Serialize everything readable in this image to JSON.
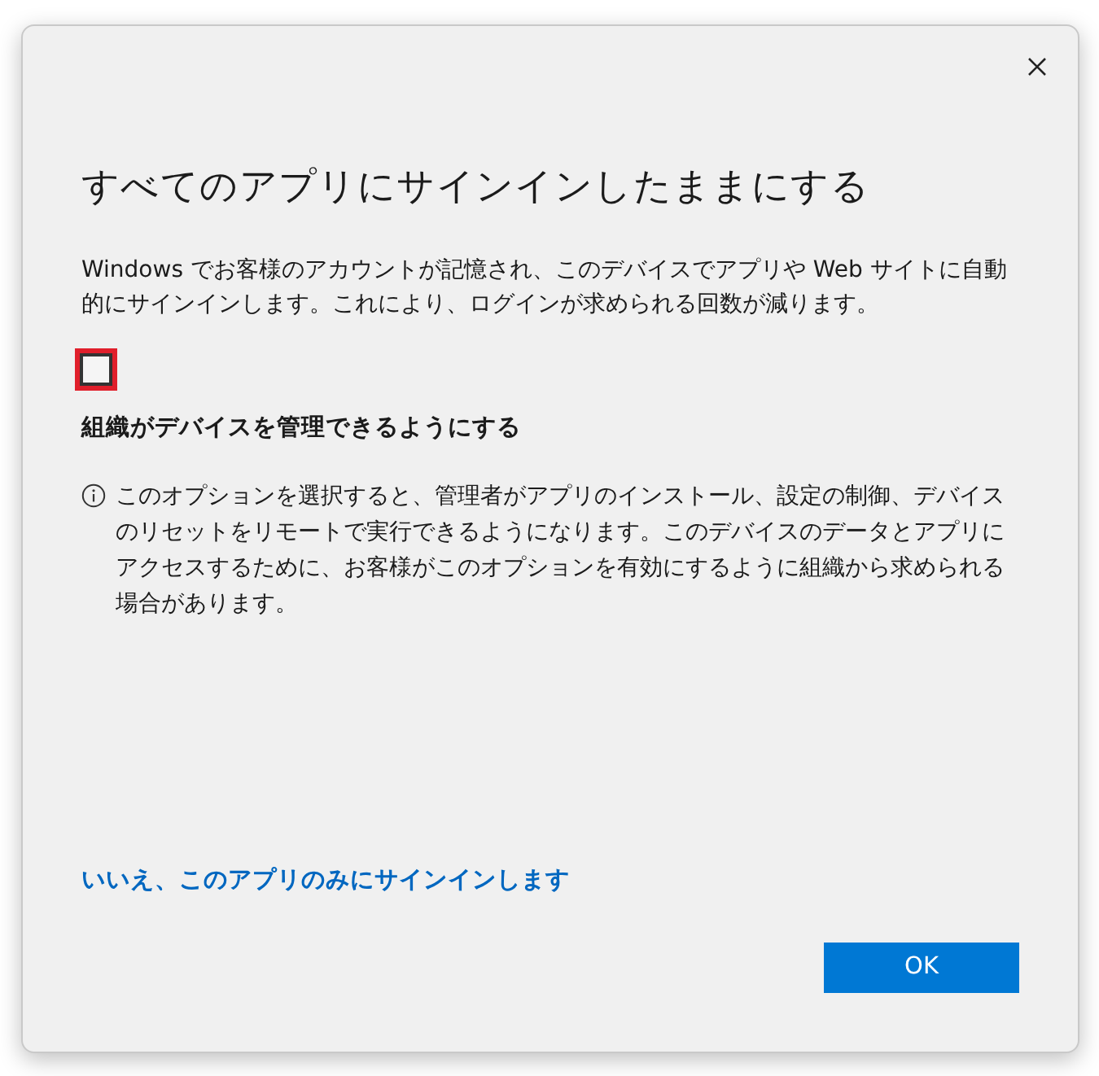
{
  "dialog": {
    "title": "すべてのアプリにサインインしたままにする",
    "description": "Windows でお客様のアカウントが記憶され、このデバイスでアプリや Web サイトに自動的にサインインします。これにより、ログインが求められる回数が減ります。",
    "checkbox": {
      "label": "組織がデバイスを管理できるようにする",
      "checked": false,
      "highlighted": true
    },
    "info": "このオプションを選択すると、管理者がアプリのインストール、設定の制御、デバイスのリセットをリモートで実行できるようになります。このデバイスのデータとアプリにアクセスするために、お客様がこのオプションを有効にするように組織から求められる場合があります。",
    "link": "いいえ、このアプリのみにサインインします",
    "buttons": [
      {
        "label": "OK",
        "kind": "primary"
      }
    ]
  }
}
